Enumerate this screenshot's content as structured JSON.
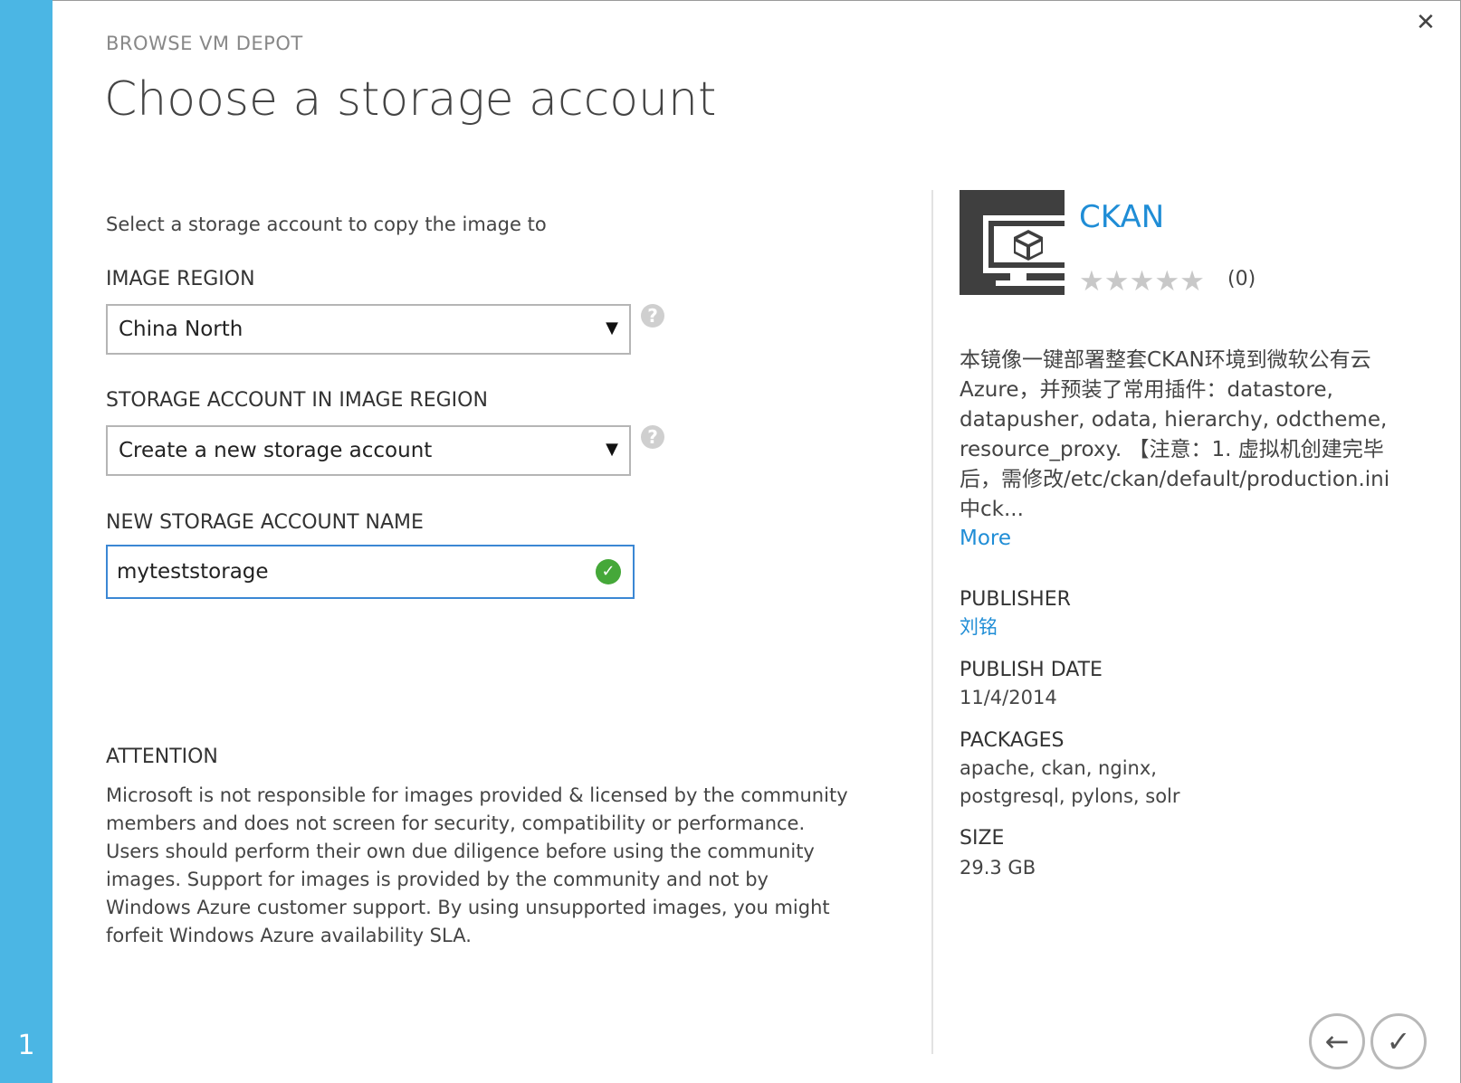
{
  "step": "1",
  "dialog": {
    "kicker": "BROWSE VM DEPOT",
    "title": "Choose a storage account",
    "instructions": "Select a storage account to copy the image to"
  },
  "form": {
    "image_region": {
      "label": "IMAGE REGION",
      "value": "China North"
    },
    "storage_account": {
      "label": "STORAGE ACCOUNT IN IMAGE REGION",
      "value": "Create a new storage account"
    },
    "new_account_name": {
      "label": "NEW STORAGE ACCOUNT NAME",
      "value": "myteststorage"
    }
  },
  "attention": {
    "title": "ATTENTION",
    "text": "Microsoft is not responsible for images provided & licensed by the community members and does not screen for security, compatibility or performance. Users should perform their own due diligence before using the community images. Support for images is provided by the community and not by Windows Azure customer support.  By using unsupported images, you might forfeit Windows Azure availability SLA."
  },
  "image_info": {
    "name": "CKAN",
    "rating_stars": "★★★★★",
    "rating_count": "(0)",
    "description": "本镜像一键部署整套CKAN环境到微软公有云Azure，并预装了常用插件：datastore, datapusher, odata, hierarchy, odctheme, resource_proxy. 【注意：1. 虚拟机创建完毕后，需修改/etc/ckan/default/production.ini中ck...",
    "more_label": "More",
    "publisher_label": "PUBLISHER",
    "publisher": "刘铭",
    "publish_date_label": "PUBLISH DATE",
    "publish_date": "11/4/2014",
    "packages_label": "PACKAGES",
    "packages": "apache, ckan, nginx, postgresql, pylons, solr",
    "size_label": "SIZE",
    "size": "29.3 GB"
  },
  "icons": {
    "close": "close-icon",
    "help": "help-icon",
    "valid": "checkmark-circle-icon",
    "back": "arrow-left-icon",
    "complete": "checkmark-icon"
  },
  "colors": {
    "accent": "#1f8dd6",
    "sidebar": "#4bb6e4",
    "valid": "#45a839"
  }
}
